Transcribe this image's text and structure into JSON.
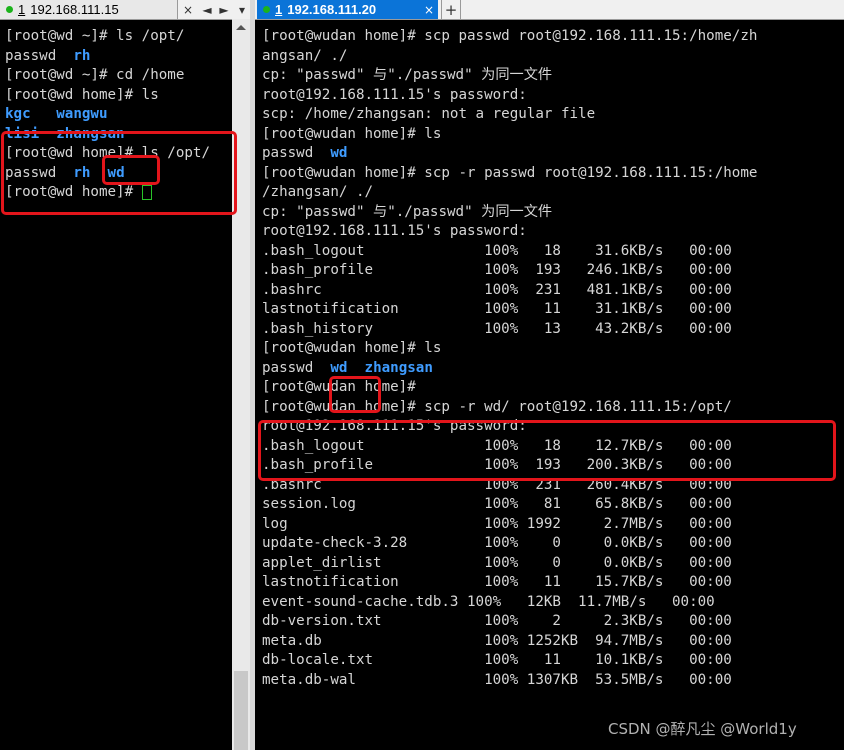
{
  "left_pane": {
    "tab": {
      "number": "1",
      "title": "192.168.111.15"
    },
    "tab_controls": {
      "close": "×",
      "prev": "◄",
      "next": "►",
      "menu": "▾"
    },
    "lines": [
      [
        {
          "t": "[root@wd ~]# ls /opt/"
        }
      ],
      [
        {
          "t": "passwd  "
        },
        {
          "t": "rh",
          "c": "blue"
        }
      ],
      [
        {
          "t": "[root@wd ~]# cd /home"
        }
      ],
      [
        {
          "t": "[root@wd home]# ls"
        }
      ],
      [
        {
          "t": "kgc",
          "c": "blue"
        },
        {
          "t": "   "
        },
        {
          "t": "wangwu",
          "c": "blue"
        }
      ],
      [
        {
          "t": "lisi",
          "c": "blue"
        },
        {
          "t": "  "
        },
        {
          "t": "zhangsan",
          "c": "blue"
        }
      ],
      [
        {
          "t": "[root@wd home]# ls /opt/"
        }
      ],
      [
        {
          "t": "passwd  "
        },
        {
          "t": "rh",
          "c": "blue"
        },
        {
          "t": "  "
        },
        {
          "t": "wd",
          "c": "blue"
        }
      ],
      [
        {
          "t": "[root@wd home]# "
        },
        {
          "cursor": true
        }
      ]
    ]
  },
  "right_pane": {
    "tab": {
      "number": "1",
      "title": "192.168.111.20"
    },
    "tab_controls": {
      "close": "×",
      "add": "+"
    },
    "lines": [
      [
        {
          "t": "[root@wudan home]# scp passwd root@192.168.111.15:/home/zh"
        }
      ],
      [
        {
          "t": "angsan/ ./"
        }
      ],
      [
        {
          "t": "cp: \"passwd\" 与\"./passwd\" 为同一文件"
        }
      ],
      [
        {
          "t": "root@192.168.111.15's password:"
        }
      ],
      [
        {
          "t": "scp: /home/zhangsan: not a regular file"
        }
      ],
      [
        {
          "t": "[root@wudan home]# ls"
        }
      ],
      [
        {
          "t": "passwd  "
        },
        {
          "t": "wd",
          "c": "blue"
        }
      ],
      [
        {
          "t": "[root@wudan home]# scp -r passwd root@192.168.111.15:/home"
        }
      ],
      [
        {
          "t": "/zhangsan/ ./"
        }
      ],
      [
        {
          "t": "cp: \"passwd\" 与\"./passwd\" 为同一文件"
        }
      ],
      [
        {
          "t": "root@192.168.111.15's password:"
        }
      ],
      [
        {
          "t": ".bash_logout              100%   18    31.6KB/s   00:00"
        }
      ],
      [
        {
          "t": ".bash_profile             100%  193   246.1KB/s   00:00"
        }
      ],
      [
        {
          "t": ".bashrc                   100%  231   481.1KB/s   00:00"
        }
      ],
      [
        {
          "t": "lastnotification          100%   11    31.1KB/s   00:00"
        }
      ],
      [
        {
          "t": ".bash_history             100%   13    43.2KB/s   00:00"
        }
      ],
      [
        {
          "t": "[root@wudan home]# ls"
        }
      ],
      [
        {
          "t": "passwd  "
        },
        {
          "t": "wd",
          "c": "blue"
        },
        {
          "t": "  "
        },
        {
          "t": "zhangsan",
          "c": "blue"
        }
      ],
      [
        {
          "t": "[root@wudan home]#"
        }
      ],
      [
        {
          "t": "[root@wudan home]# scp -r wd/ root@192.168.111.15:/opt/"
        }
      ],
      [
        {
          "t": "root@192.168.111.15's password:"
        }
      ],
      [
        {
          "t": ".bash_logout              100%   18    12.7KB/s   00:00"
        }
      ],
      [
        {
          "t": ".bash_profile             100%  193   200.3KB/s   00:00"
        }
      ],
      [
        {
          "t": ".bashrc                   100%  231   260.4KB/s   00:00"
        }
      ],
      [
        {
          "t": "session.log               100%   81    65.8KB/s   00:00"
        }
      ],
      [
        {
          "t": "log                       100% 1992     2.7MB/s   00:00"
        }
      ],
      [
        {
          "t": "update-check-3.28         100%    0     0.0KB/s   00:00"
        }
      ],
      [
        {
          "t": "applet_dirlist            100%    0     0.0KB/s   00:00"
        }
      ],
      [
        {
          "t": "lastnotification          100%   11    15.7KB/s   00:00"
        }
      ],
      [
        {
          "t": "event-sound-cache.tdb.3 100%   12KB  11.7MB/s   00:00"
        }
      ],
      [
        {
          "t": "db-version.txt            100%    2     2.3KB/s   00:00"
        }
      ],
      [
        {
          "t": "meta.db                   100% 1252KB  94.7MB/s   00:00"
        }
      ],
      [
        {
          "t": "db-locale.txt             100%   11    10.1KB/s   00:00"
        }
      ],
      [
        {
          "t": "meta.db-wal               100% 1307KB  53.5MB/s   00:00"
        }
      ]
    ]
  },
  "watermark": "CSDN @醉凡尘 @World1y",
  "colors": {
    "highlight": "#e3151b",
    "dir_blue": "#3f9cff",
    "text": "#d6d6d6",
    "tab_active": "#0b74d8"
  }
}
